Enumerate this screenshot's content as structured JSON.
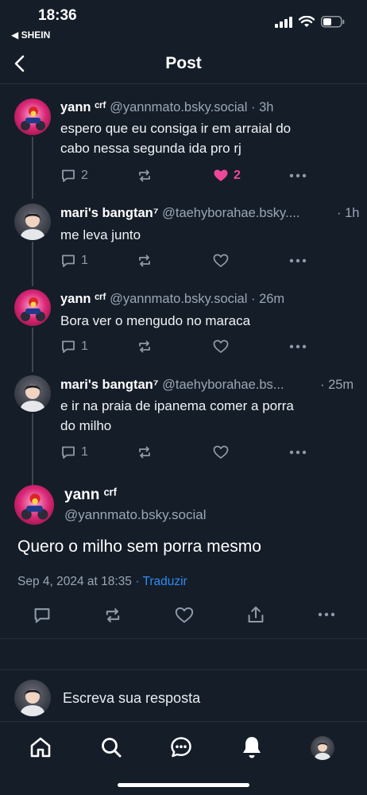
{
  "status": {
    "time": "18:36",
    "back_app": "◀ SHEIN"
  },
  "header": {
    "title": "Post"
  },
  "colors": {
    "background": "#151d28",
    "accent": "#2f8cf5",
    "like": "#ec4899",
    "muted": "#8f9baa"
  },
  "thread": [
    {
      "name": "yann ᶜʳᶠ",
      "handle": "@yannmato.bsky.social",
      "time": "· 3h",
      "text_lines": [
        "espero que eu consiga ir em arraial do",
        "cabo nessa segunda ida pro rj"
      ],
      "replies": "2",
      "likes": "2"
    },
    {
      "name": "mari's bangtan⁷",
      "handle": "@taehyborahae.bsky....",
      "time": "· 1h",
      "text_lines": [
        "me leva junto"
      ],
      "replies": "1"
    },
    {
      "name": "yann ᶜʳᶠ",
      "handle": "@yannmato.bsky.social",
      "time": "· 26m",
      "text_lines": [
        "Bora ver o mengudo no maraca"
      ],
      "replies": "1"
    },
    {
      "name": "mari's bangtan⁷",
      "handle": "@taehyborahae.bs...",
      "time": "· 25m",
      "text_lines": [
        "e ir na praia de ipanema comer a porra",
        "do milho"
      ],
      "replies": "1"
    }
  ],
  "main_post": {
    "name": "yann ᶜʳᶠ",
    "handle": "@yannmato.bsky.social",
    "text": "Quero o milho sem porra mesmo",
    "date": "Sep 4, 2024 at 18:35",
    "dot": " · ",
    "translate": "Traduzir"
  },
  "reply": {
    "placeholder": "Escreva sua resposta"
  },
  "icons": [
    "chevron-left-icon",
    "reply-icon",
    "repost-icon",
    "heart-icon",
    "more-icon",
    "share-icon",
    "home-icon",
    "search-icon",
    "chat-icon",
    "bell-icon"
  ]
}
